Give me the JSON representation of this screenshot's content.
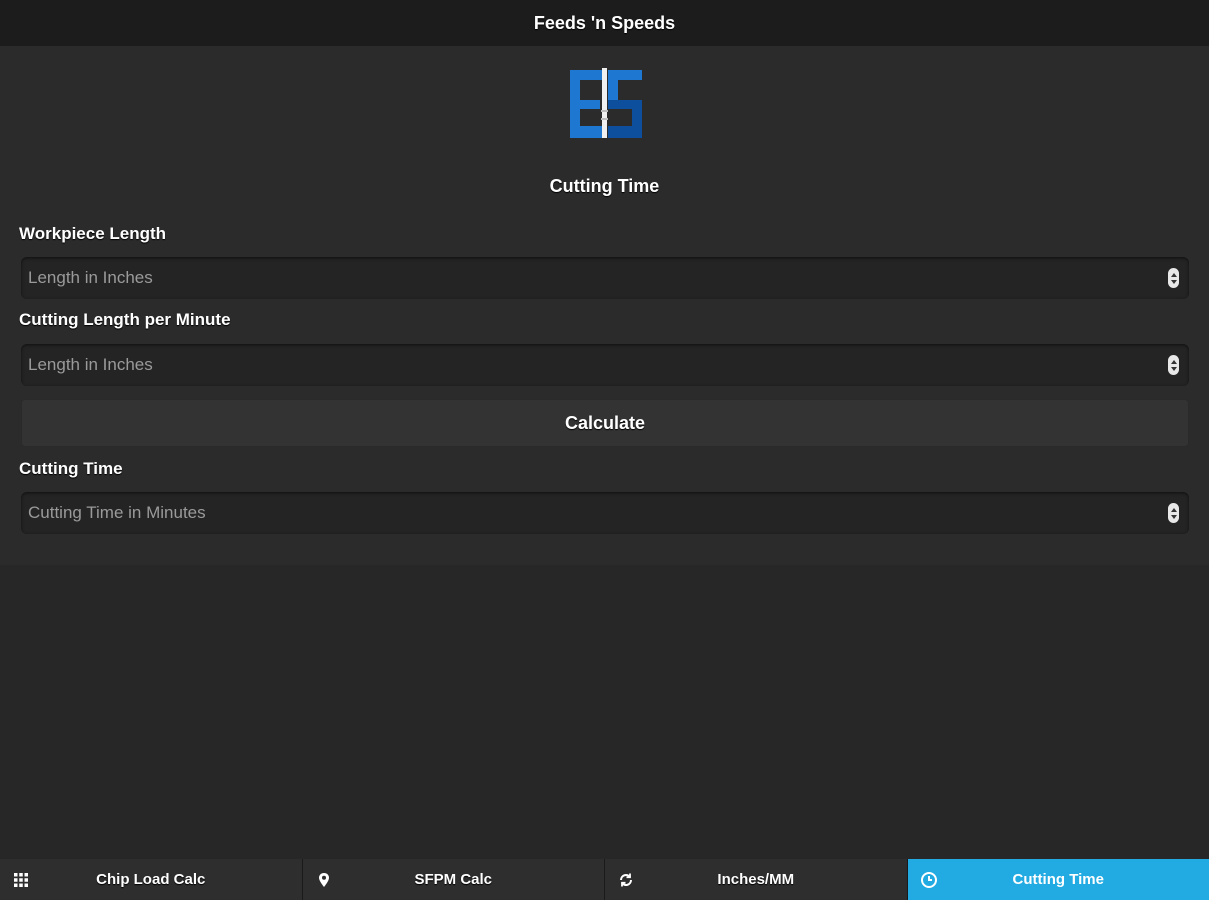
{
  "header": {
    "title": "Feeds 'n Speeds"
  },
  "logo": {
    "icon": "fs-logo-icon",
    "colors": {
      "blue": "#1e78d2",
      "dark_blue": "#0d4f9c",
      "white": "#f0f0f0"
    }
  },
  "page": {
    "title": "Cutting Time"
  },
  "form": {
    "workpiece_length": {
      "label": "Workpiece Length",
      "placeholder": "Length in Inches",
      "value": ""
    },
    "cutting_length_per_minute": {
      "label": "Cutting Length per Minute",
      "placeholder": "Length in Inches",
      "value": ""
    },
    "calculate_label": "Calculate",
    "cutting_time": {
      "label": "Cutting Time",
      "placeholder": "Cutting Time in Minutes",
      "value": ""
    }
  },
  "tabs": [
    {
      "label": "Chip Load Calc",
      "icon": "grid-icon",
      "active": false
    },
    {
      "label": "SFPM Calc",
      "icon": "map-pin-icon",
      "active": false
    },
    {
      "label": "Inches/MM",
      "icon": "refresh-icon",
      "active": false
    },
    {
      "label": "Cutting Time",
      "icon": "clock-icon",
      "active": true
    }
  ],
  "colors": {
    "accent": "#22aae2",
    "background": "#272727",
    "header": "#1c1c1c"
  }
}
